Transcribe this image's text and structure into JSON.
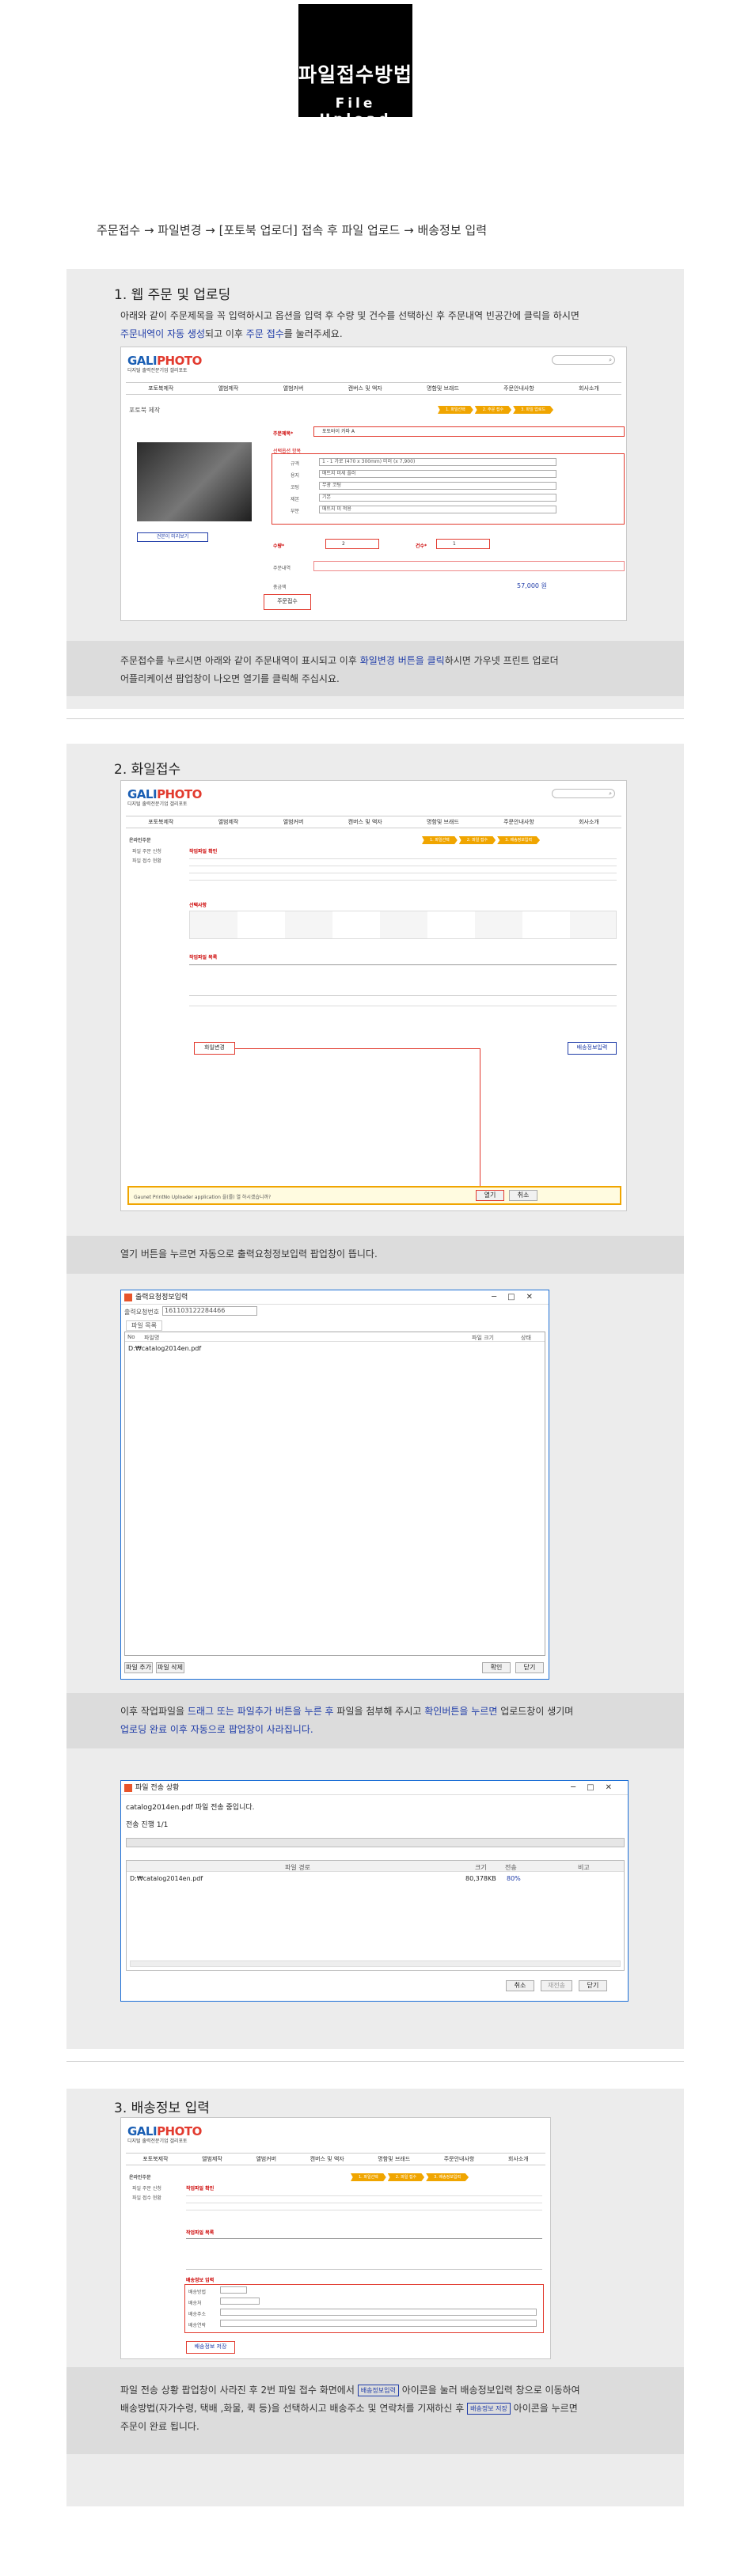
{
  "header": {
    "title_ko": "파일접수방법",
    "title_en": "File Upload"
  },
  "flow": "주문접수 → 파일변경 → [포토북 업로더] 접속 후 파일 업로드 → 배송정보 입력",
  "step1": {
    "title": "1. 웹 주문 및 업로딩",
    "desc_a": "아래와 같이 주문제목을 꼭 입력하시고 옵션을 입력 후 수량 및 건수를 선택하신 후 주문내역 빈공간에 클릭을 하시면",
    "desc_b_hl1": "주문내역이 자동 생성",
    "desc_b_mid": "되고 이후 ",
    "desc_b_hl2": "주문 접수",
    "desc_b_end": "를 눌러주세요.",
    "shot": {
      "logo_a": "GALI",
      "logo_b": "PHOTO",
      "logo_sub": "디지털 출력전문기업 갤리포토",
      "nav": [
        "포토북제작",
        "앨범제작",
        "앨범커버",
        "캔버스 및 액자",
        "명함및 브래드",
        "주문안내사항",
        "회사소개"
      ],
      "side": "포토북 제작",
      "steps": [
        "1. 파일선택",
        "2. 주문 접수",
        "3. 파일 업로드"
      ],
      "order_title_label": "주문제목*",
      "order_title_value": "포토바이 카파 A",
      "option_label": "선택옵션 항목",
      "options": [
        {
          "k": "규격",
          "v": "1 - 1 가로 (470 x 300mm) 미러 (x 7,900)"
        },
        {
          "k": "용지",
          "v": "매트지 미세 플러"
        },
        {
          "k": "코팅",
          "v": "무광 코팅"
        },
        {
          "k": "제본",
          "v": "기본"
        },
        {
          "k": "부분",
          "v": "매트지 미 적용"
        }
      ],
      "qty_label": "수량*",
      "qty_value": "2",
      "count_label": "건수*",
      "count_value": "1",
      "order_detail_label": "주문내역",
      "price_label": "총금액",
      "price_value": "57,000 원",
      "view_btn": "견본이 미리보기",
      "submit_btn": "주문접수"
    },
    "note_a": "주문접수를 누르시면 아래와 같이 주문내역이 표시되고 이후 ",
    "note_hl": "화일변경 버튼을 클릭",
    "note_b": "하시면 가우넷 프린트 업로더",
    "note_c": "어플리케이션 팝업창이 나오면 열기를 클릭해 주십시요."
  },
  "step2": {
    "title": "2. 화일접수",
    "shot": {
      "side_title": "온라인주문",
      "side_items": [
        "파일 주문 신청",
        "파일 접수 현황"
      ],
      "steps": [
        "1. 파일선택",
        "2. 파일 접수",
        "3. 배송정보입력"
      ],
      "sec_a": "작업파일 확인",
      "sec_b": "선택사항",
      "sec_c": "작업파일 목록",
      "file_change_btn": "화일변경",
      "ship_btn": "배송정보입력",
      "dialog_text": "Gaunet PrintNo Uploader application 을(를) 열 하시겠습니까?",
      "dialog_open": "열기",
      "dialog_cancel": "취소"
    },
    "note1": "열기 버튼을 누르면 자동으로 출력요청정보입력 팝업창이 뜹니다.",
    "win1": {
      "title": "출력요청정보입력",
      "order_no_label": "출력요청번호",
      "order_no": "161103122284466",
      "tab": "파일 목록",
      "col_no": "No",
      "col_name": "파일명",
      "col_size": "파일 크기",
      "col_state": "상태",
      "file": "D:₩catalog2014en.pdf",
      "add_btn": "파일 추가",
      "del_btn": "파일 삭제",
      "ok_btn": "확인",
      "close_btn": "닫기"
    },
    "note2_a": "이후 작업파일을 ",
    "note2_hl1": "드래그 또는 파일추가 버튼을 누른 후",
    "note2_b": " 파일을 첨부해 주시고 ",
    "note2_hl2": "확인버튼을 누르면",
    "note2_c": " 업로드창이 생기며",
    "note2_hl3": "업로딩 완료 이후 자동으로 팝업창이 사라집니다.",
    "win2": {
      "title": "파일 전송 상황",
      "line1": "catalog2014en.pdf 파일 전송 중입니다.",
      "line2": "전송 진행 1/1",
      "col_path": "파일 경로",
      "col_size": "크기",
      "col_rate": "전송",
      "col_note": "비고",
      "file": "D:₩catalog2014en.pdf",
      "size": "80,378KB",
      "rate": "80%",
      "cancel_btn": "취소",
      "retry_btn": "재전송",
      "close_btn": "닫기"
    }
  },
  "step3": {
    "title": "3. 배송정보 입력",
    "shot": {
      "ship_section": "배송정보 입력",
      "fields": [
        "배송방법",
        "배송처",
        "배송주소",
        "배송연락"
      ],
      "save_btn": "배송정보 저장"
    },
    "note_a": "파일 전송 상황 팝업창이 사라진 후 2번 파일 접수 화면에서 ",
    "chip1": "배송정보입력",
    "note_b": " 아이콘을 눌러 배송정보입력 창으로 이동하여",
    "note_c": "배송방법(자가수령, 택배 ,화물, 퀵 등)을 선택하시고 배송주소 및 연락처를 기재하신 후 ",
    "chip2": "배송정보 저장",
    "note_d": " 아이콘을 누르면",
    "note_e": "주문이 완료 됩니다."
  }
}
